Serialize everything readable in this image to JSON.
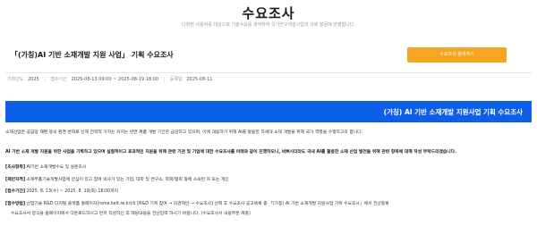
{
  "header": {
    "title": "수요조사",
    "subtitle": "다양한 사용자를 대상으로 기술수요를 파악하여 국가연구개발사업의 과제 발굴에 반영합니다."
  },
  "survey": {
    "title": "「(가칭)AI 기반 소재개발 지원 사업」 기획 수요조사",
    "apply_button": "수요조사 참여하기",
    "info": [
      {
        "label": "기획년도",
        "value": "2025"
      },
      {
        "label": "접수기간",
        "value": "2025-08-13 09:00 ~ 2025-08-19 18:00"
      },
      {
        "label": "등록일",
        "value": "2025-08-11"
      }
    ]
  },
  "banner": {
    "text": "(가칭) AI 기반 소재개발 지원사업 기획 수요조사"
  },
  "content": {
    "intro": "소재산업은 공급망 재편 등의 환경 변화로 인해 전략적 가치는 커지는 반면 제품 개발 기간은 급감하고 있으며, 이에 대응하기 위해 AI를 활용한 차세대 소재 개발을 위해 국가 역할을 수행하고자 합니다.",
    "purpose": "AI 기반 소재 개발 지원을 위한 사업을 기획하고 있으며 실질적이고 효과적인 지원을 위해 관련 기관 및 기업에 대한 수요조사를 아래와 같이 진행하오니, 바쁘시더라도 국내 AI를 활용한 소재 산업 발전을 위해 관련 항목에 대해 작성 부탁드리겠습니다.",
    "items": [
      {
        "tag": "[조사항목]",
        "text": " AI기반 소재개발수요 및 설문조사"
      },
      {
        "tag": "[제안자격]",
        "text": " 소재부품기술개발사업에 관심이 있고 참여 의사가 있는 기업, 대학 및 연구소, 학회/협회 등에 소속된 자 또는 개인"
      },
      {
        "tag": "[접수기간]",
        "text": " 2025. 8. 13(수) ~ 2025. 8. 19(화) 18:00까지"
      },
      {
        "tag": "[접수방법]",
        "text": " 산업기술 R&D 디지털 플랫폼 홈페이지(rome.keit.re.kr)의 [R&D 기획 참여 → 의견제안 → 수요조사] 선택 후 수요조사 공고목록 중 「(가칭) AI 기반 소재개발 지원사업 기획 수요조사」에서 전산등록"
      }
    ],
    "note": "수요조사서 양식을 홈페이지에서 다운로드하시고 먼저 작성하신 후 해당내용을 전산입력 하시기 바랍니다. (수요조사서 내용부분 제출)"
  }
}
